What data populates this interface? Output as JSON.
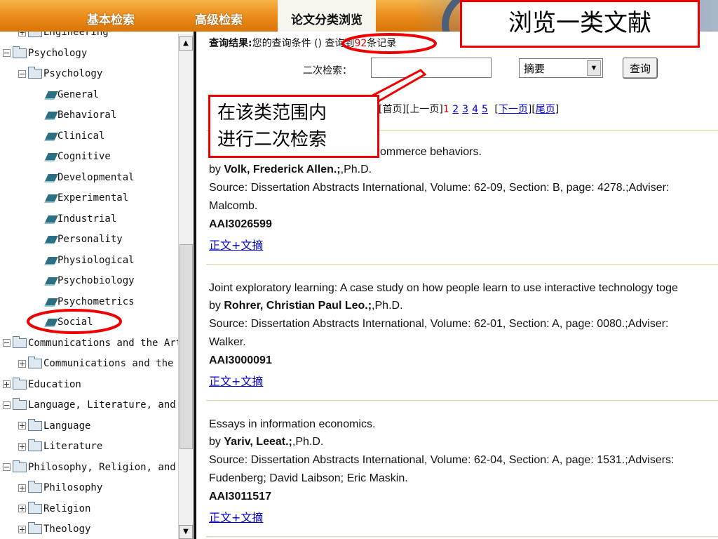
{
  "tabs": [
    {
      "label": "基本检索"
    },
    {
      "label": "高级检索"
    },
    {
      "label": "论文分类浏览"
    }
  ],
  "tree": {
    "rows": [
      {
        "label": "Engineering",
        "icon": "folder",
        "expander": "plus",
        "indent": 1
      },
      {
        "label": "Psychology",
        "icon": "folder-open",
        "expander": "minus",
        "indent": 0
      },
      {
        "label": "Psychology",
        "icon": "folder-open",
        "expander": "minus",
        "indent": 1
      },
      {
        "label": "General",
        "icon": "book",
        "indent": 2
      },
      {
        "label": "Behavioral",
        "icon": "book",
        "indent": 2
      },
      {
        "label": "Clinical",
        "icon": "book",
        "indent": 2
      },
      {
        "label": "Cognitive",
        "icon": "book",
        "indent": 2
      },
      {
        "label": "Developmental",
        "icon": "book",
        "indent": 2
      },
      {
        "label": "Experimental",
        "icon": "book",
        "indent": 2
      },
      {
        "label": "Industrial",
        "icon": "book",
        "indent": 2
      },
      {
        "label": "Personality",
        "icon": "book",
        "indent": 2
      },
      {
        "label": "Physiological",
        "icon": "book",
        "indent": 2
      },
      {
        "label": "Psychobiology",
        "icon": "book",
        "indent": 2
      },
      {
        "label": "Psychometrics",
        "icon": "book",
        "indent": 2
      },
      {
        "label": "Social",
        "icon": "book",
        "indent": 2
      },
      {
        "label": "Communications and the Art",
        "icon": "folder-open",
        "expander": "minus",
        "indent": 0
      },
      {
        "label": "Communications and the",
        "icon": "folder",
        "expander": "plus",
        "indent": 1
      },
      {
        "label": "Education",
        "icon": "folder",
        "expander": "plus",
        "indent": 0
      },
      {
        "label": "Language, Literature, and",
        "icon": "folder-open",
        "expander": "minus",
        "indent": 0
      },
      {
        "label": "Language",
        "icon": "folder",
        "expander": "plus",
        "indent": 1
      },
      {
        "label": "Literature",
        "icon": "folder",
        "expander": "plus",
        "indent": 1
      },
      {
        "label": "Philosophy, Religion, and",
        "icon": "folder-open",
        "expander": "minus",
        "indent": 0
      },
      {
        "label": "Philosophy",
        "icon": "folder",
        "expander": "plus",
        "indent": 1
      },
      {
        "label": "Religion",
        "icon": "folder",
        "expander": "plus",
        "indent": 1
      },
      {
        "label": "Theology",
        "icon": "folder",
        "expander": "plus",
        "indent": 1
      }
    ]
  },
  "query": {
    "result_label": "查询结果:",
    "condition_text": "您的查询条件",
    "paren": "()",
    "count_prefix": "查询到",
    "count": "92",
    "count_suffix": "条记录"
  },
  "secondary_search": {
    "label": "二次检索：",
    "value": "",
    "field_value": "摘要",
    "button_label": "查询"
  },
  "pagination": {
    "first": "[首页]",
    "prev": "[上一页]",
    "current": "1",
    "pages": [
      "2",
      "3",
      "4",
      "5"
    ],
    "next_open": "[",
    "next": "下一页",
    "next_close": "]",
    "last_open": "[",
    "last": "尾页",
    "last_close": "]"
  },
  "records": [
    {
      "title": "ommerce behaviors.",
      "by": "by ",
      "author": "Volk, Frederick Allen.;",
      "degree": ",Ph.D.",
      "source": "Source: Dissertation Abstracts International, Volume: 62-09, Section: B, page: 4278.;Adviser:",
      "source2": "Malcomb.",
      "id": "AAI3026599",
      "link": "正文+文摘"
    },
    {
      "title": "Joint exploratory learning: A case study on how people learn to use interactive technology toge",
      "by": "by ",
      "author": "Rohrer, Christian Paul Leo.;",
      "degree": ",Ph.D.",
      "source": "Source: Dissertation Abstracts International, Volume: 62-01, Section: A, page: 0080.;Adviser:",
      "source2": "Walker.",
      "id": "AAI3000091",
      "link": "正文+文摘"
    },
    {
      "title": "Essays in information economics.",
      "by": "by ",
      "author": "Yariv, Leeat.;",
      "degree": ",Ph.D.",
      "source": "Source: Dissertation Abstracts International, Volume: 62-04, Section: A, page: 1531.;Advisers:",
      "source2": "Fudenberg; David Laibson; Eric Maskin.",
      "id": "AAI3011517",
      "link": "正文+文摘"
    }
  ],
  "annotations": {
    "title": "浏览一类文献",
    "callout_line1": "在该类范围内",
    "callout_line2": "进行二次检索"
  },
  "colors": {
    "tab_bar": "#e98a18",
    "link": "#0000cc",
    "annotation_red": "#e00000",
    "count_red": "#dd0000"
  }
}
